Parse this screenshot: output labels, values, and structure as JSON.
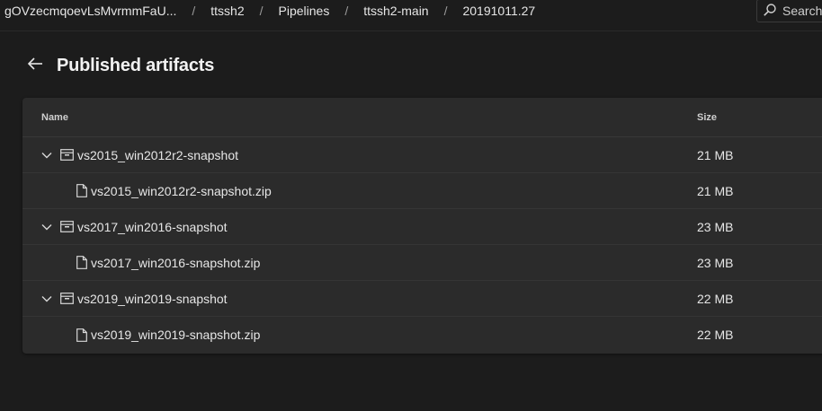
{
  "breadcrumb": {
    "items": [
      "gOVzecmqoevLsMvrmmFaU...",
      "ttssh2",
      "Pipelines",
      "ttssh2-main",
      "20191011.27"
    ],
    "separator": "/"
  },
  "search": {
    "label": "Search"
  },
  "page": {
    "title": "Published artifacts"
  },
  "table": {
    "columns": {
      "name": "Name",
      "size": "Size"
    },
    "rows": [
      {
        "type": "artifact",
        "name": "vs2015_win2012r2-snapshot",
        "size": "21 MB",
        "expanded": true
      },
      {
        "type": "file",
        "name": "vs2015_win2012r2-snapshot.zip",
        "size": "21 MB"
      },
      {
        "type": "artifact",
        "name": "vs2017_win2016-snapshot",
        "size": "23 MB",
        "expanded": true
      },
      {
        "type": "file",
        "name": "vs2017_win2016-snapshot.zip",
        "size": "23 MB"
      },
      {
        "type": "artifact",
        "name": "vs2019_win2019-snapshot",
        "size": "22 MB",
        "expanded": true
      },
      {
        "type": "file",
        "name": "vs2019_win2019-snapshot.zip",
        "size": "22 MB"
      }
    ]
  },
  "icons": {
    "back": "arrow-left-icon",
    "search": "search-icon",
    "expand": "chevron-down-icon",
    "artifact": "artifact-package-icon",
    "file": "file-icon"
  },
  "colors": {
    "background": "#1c1c1c",
    "card": "#2b2b2b",
    "text": "#e6e6e6"
  }
}
